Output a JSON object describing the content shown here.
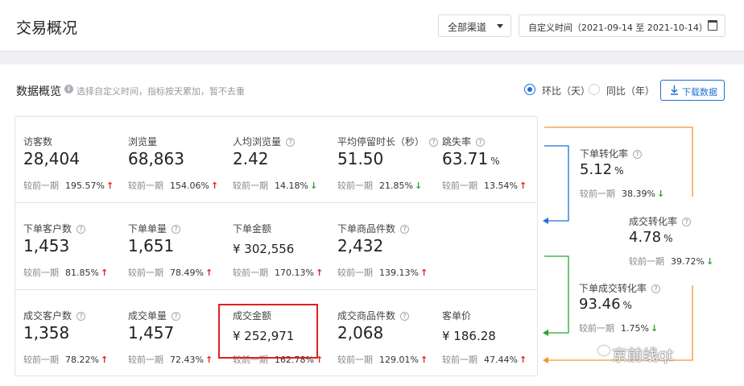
{
  "header": {
    "title": "交易概况",
    "channel_select": "全部渠道",
    "date_range": "自定义时间（2021-09-14 至 2021-10-14）"
  },
  "overview": {
    "title": "数据概览",
    "hint": "选择自定义时间，指标按天累加，暂不去重",
    "period_options": [
      {
        "label": "环比（天）",
        "selected": true
      },
      {
        "label": "同比（年）",
        "selected": false
      }
    ],
    "download_label": "下载数据",
    "compare_label": "较前一期"
  },
  "metrics": [
    {
      "label": "访客数",
      "value": "28,404",
      "change": "195.57%",
      "trend": "up",
      "help": false
    },
    {
      "label": "浏览量",
      "value": "68,863",
      "change": "154.06%",
      "trend": "up",
      "help": false
    },
    {
      "label": "人均浏览量",
      "value": "2.42",
      "change": "14.18%",
      "trend": "down",
      "help": true
    },
    {
      "label": "平均停留时长（秒）",
      "value": "51.50",
      "change": "21.85%",
      "trend": "down",
      "help": true
    },
    {
      "label": "跳失率",
      "value": "63.71",
      "unit": "%",
      "change": "13.54%",
      "trend": "up",
      "help": true
    },
    {
      "label": "下单客户数",
      "value": "1,453",
      "change": "81.85%",
      "trend": "up",
      "help": true
    },
    {
      "label": "下单单量",
      "value": "1,651",
      "change": "78.49%",
      "trend": "up",
      "help": true
    },
    {
      "label": "下单金额",
      "value": "¥ 302,556",
      "change": "170.13%",
      "trend": "up",
      "help": false
    },
    {
      "label": "下单商品件数",
      "value": "2,432",
      "change": "139.13%",
      "trend": "up",
      "help": true
    },
    {
      "label": "成交客户数",
      "value": "1,358",
      "change": "78.22%",
      "trend": "up",
      "help": true
    },
    {
      "label": "成交单量",
      "value": "1,457",
      "change": "72.43%",
      "trend": "up",
      "help": true
    },
    {
      "label": "成交金额",
      "value": "¥ 252,971",
      "change": "162.78%",
      "trend": "up",
      "help": false
    },
    {
      "label": "成交商品件数",
      "value": "2,068",
      "change": "129.01%",
      "trend": "up",
      "help": true
    },
    {
      "label": "客单价",
      "value": "¥ 186.28",
      "change": "47.44%",
      "trend": "up",
      "help": false
    }
  ],
  "conversions": [
    {
      "label": "下单转化率",
      "value": "5.12",
      "unit": "%",
      "change": "38.39%",
      "trend": "down"
    },
    {
      "label": "成交转化率",
      "value": "4.78",
      "unit": "%",
      "change": "39.72%",
      "trend": "down"
    },
    {
      "label": "下单成交转化率",
      "value": "93.46",
      "unit": "%",
      "change": "1.75%",
      "trend": "down"
    }
  ],
  "colors": {
    "up": "#e02020",
    "down": "#2aa52a",
    "accent": "#1f6fd8",
    "highlight": "#e02020",
    "flow_blue": "#1f6fd8",
    "flow_green": "#2aa52a",
    "flow_orange": "#f0962a"
  },
  "watermark": "京前线qt"
}
